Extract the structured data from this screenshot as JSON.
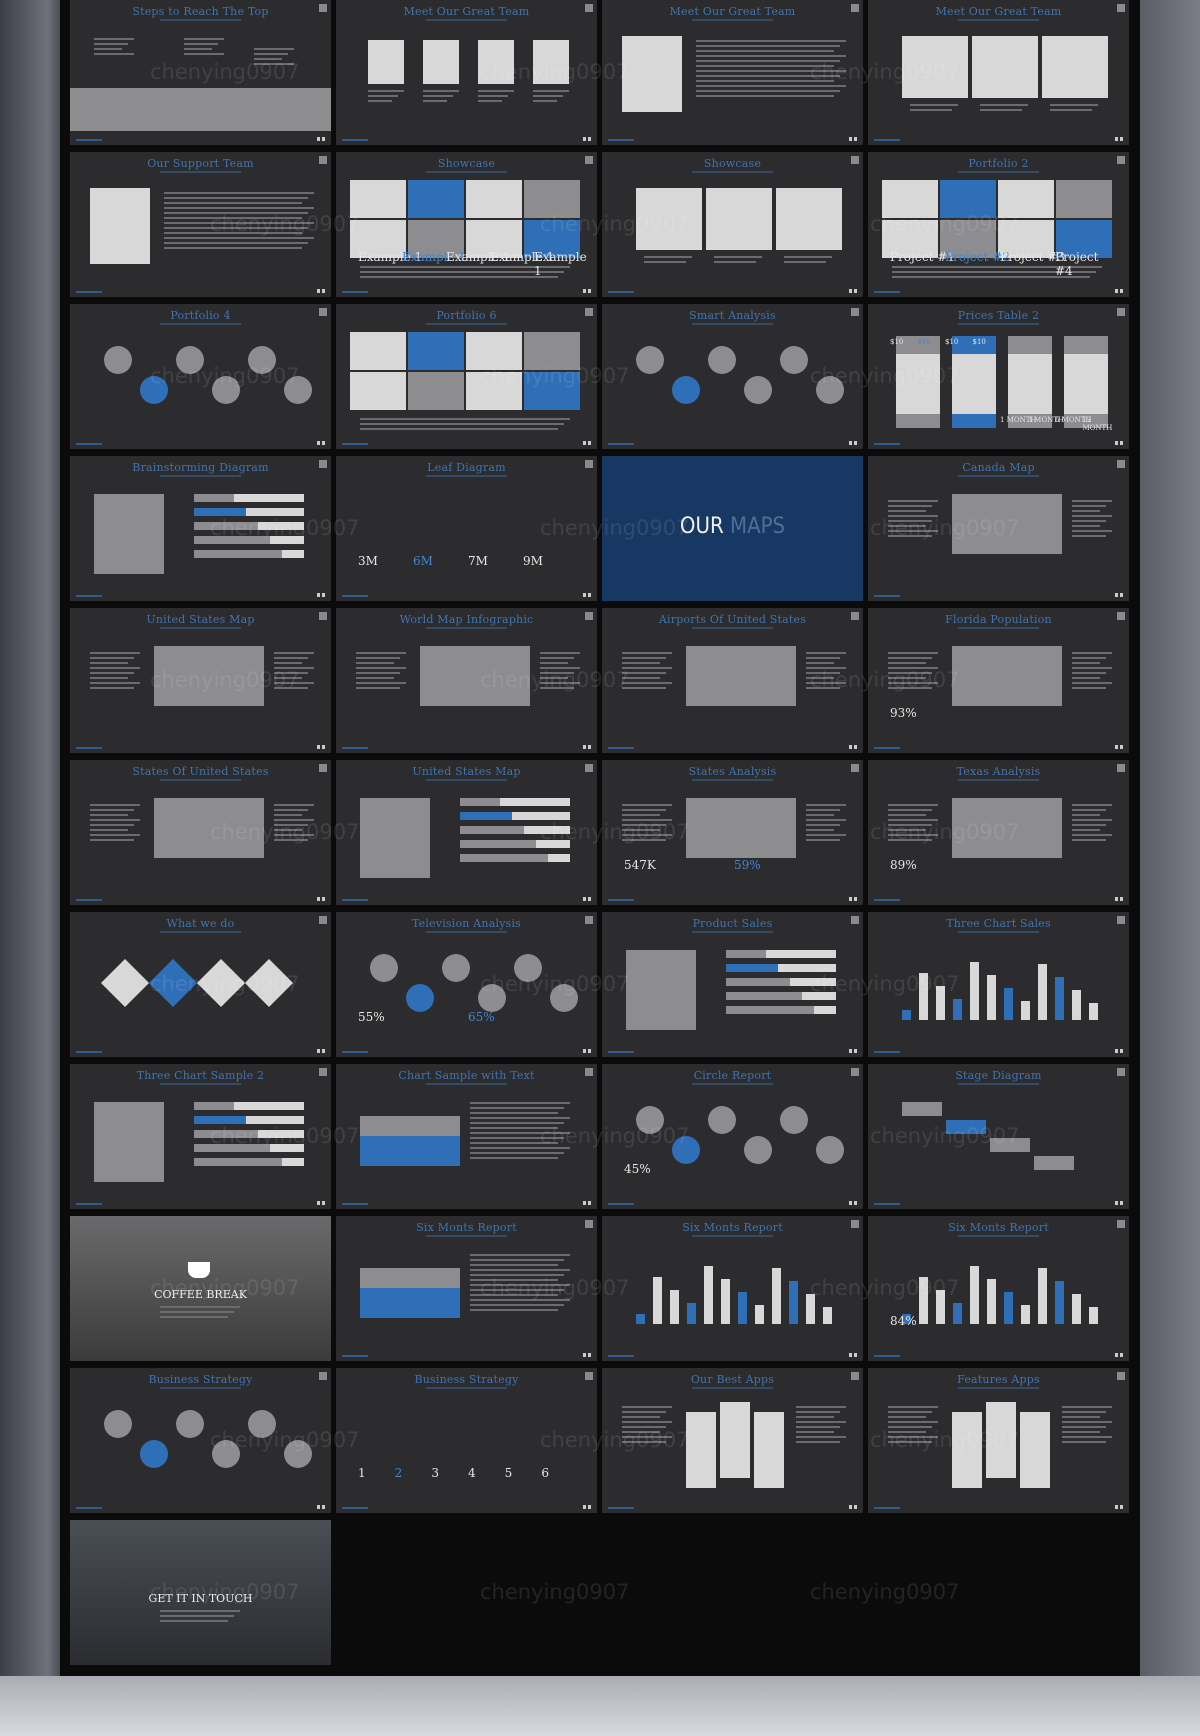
{
  "watermark": "chenying0907",
  "colors": {
    "accent": "#2f6fb8",
    "slide_bg": "#2c2c2e",
    "title": "#3f74b0",
    "maps_bg": "#173862"
  },
  "slides": [
    {
      "title": "Steps to Reach The Top",
      "kind": "mountains"
    },
    {
      "title": "Meet Our Great Team",
      "kind": "faces4"
    },
    {
      "title": "Meet Our Great Team",
      "kind": "profile"
    },
    {
      "title": "Meet Our Great Team",
      "kind": "faces3"
    },
    {
      "title": "Our Support Team",
      "kind": "profile"
    },
    {
      "title": "Showcase",
      "kind": "grid",
      "labels": [
        "Example 1",
        "Example 1",
        "Example 1",
        "Example 1",
        "Example 1"
      ]
    },
    {
      "title": "Showcase",
      "kind": "faces3"
    },
    {
      "title": "Portfolio 2",
      "kind": "grid",
      "labels": [
        "Project #1",
        "Project #2",
        "Project #3",
        "Project #4"
      ]
    },
    {
      "title": "Portfolio 4",
      "kind": "circles"
    },
    {
      "title": "Portfolio 6",
      "kind": "grid"
    },
    {
      "title": "Smart Analysis",
      "kind": "circles"
    },
    {
      "title": "Prices Table 2",
      "kind": "prices",
      "labels": [
        "$10",
        "$10",
        "$10",
        "$10",
        "1 MONTH",
        "3 MONTH",
        "6 MONTH",
        "12 MONTH"
      ]
    },
    {
      "title": "Brainstorming Diagram",
      "kind": "bars"
    },
    {
      "title": "Leaf Diagram",
      "kind": "leaf",
      "labels": [
        "3M",
        "6M",
        "7M",
        "9M"
      ]
    },
    {
      "title": "OUR MAPS",
      "kind": "maps",
      "words": [
        "OUR",
        "MAPS"
      ]
    },
    {
      "title": "Canada Map",
      "kind": "map"
    },
    {
      "title": "United States Map",
      "kind": "map"
    },
    {
      "title": "World Map Infographic",
      "kind": "map"
    },
    {
      "title": "Airports Of United States",
      "kind": "map"
    },
    {
      "title": "Florida Population",
      "kind": "map",
      "labels": [
        "93%"
      ]
    },
    {
      "title": "States Of United States",
      "kind": "map"
    },
    {
      "title": "United States Map",
      "kind": "bars"
    },
    {
      "title": "States Analysis",
      "kind": "map",
      "labels": [
        "547K",
        "59%"
      ]
    },
    {
      "title": "Texas Analysis",
      "kind": "map",
      "labels": [
        "89%"
      ]
    },
    {
      "title": "What we do",
      "kind": "diamonds"
    },
    {
      "title": "Television Analysis",
      "kind": "circles",
      "labels": [
        "55%",
        "65%"
      ]
    },
    {
      "title": "Product Sales",
      "kind": "bars"
    },
    {
      "title": "Three Chart Sales",
      "kind": "columns"
    },
    {
      "title": "Three Chart Sample 2",
      "kind": "bars"
    },
    {
      "title": "Chart Sample with Text",
      "kind": "area"
    },
    {
      "title": "Circle Report",
      "kind": "circles",
      "labels": [
        "45%"
      ]
    },
    {
      "title": "Stage Diagram",
      "kind": "stage"
    },
    {
      "title": "COFFEE BREAK",
      "kind": "photo"
    },
    {
      "title": "Six Monts Report",
      "kind": "area"
    },
    {
      "title": "Six Monts Report",
      "kind": "columns"
    },
    {
      "title": "Six Monts Report",
      "kind": "columns",
      "labels": [
        "84%"
      ]
    },
    {
      "title": "Business Strategy",
      "kind": "circles"
    },
    {
      "title": "Business Strategy",
      "kind": "leaf",
      "labels": [
        "1",
        "2",
        "3",
        "4",
        "5",
        "6"
      ]
    },
    {
      "title": "Our Best Apps",
      "kind": "phones"
    },
    {
      "title": "Features Apps",
      "kind": "phones"
    },
    {
      "title": "GET IT IN TOUCH",
      "kind": "photo2"
    }
  ]
}
